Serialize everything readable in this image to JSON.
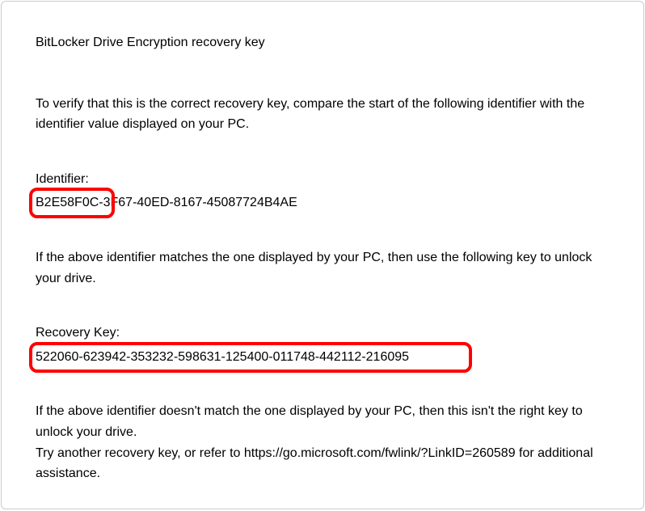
{
  "title": "BitLocker Drive Encryption recovery key",
  "intro": "To verify that this is the correct recovery key, compare the start of the following identifier with the identifier value displayed on your PC.",
  "identifier_label": "Identifier:",
  "identifier_value": "B2E58F0C-3F67-40ED-8167-45087724B4AE",
  "match_instruction": "If the above identifier matches the one displayed by your PC, then use the following key to unlock your drive.",
  "recovery_key_label": "Recovery Key:",
  "recovery_key_value": "522060-623942-353232-598631-125400-011748-442112-216095",
  "no_match_text": "If the above identifier doesn't match the one displayed by your PC, then this isn't the right key to unlock your drive.",
  "help_text": "Try another recovery key, or refer to https://go.microsoft.com/fwlink/?LinkID=260589 for additional assistance."
}
